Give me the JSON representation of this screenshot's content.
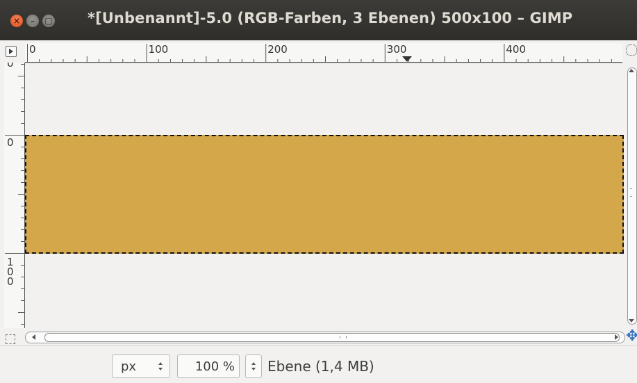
{
  "window": {
    "title": "*[Unbenannt]-5.0 (RGB-Farben, 3 Ebenen) 500x100 – GIMP",
    "close_glyph": "×",
    "minimize_glyph": "–",
    "maximize_glyph": "□"
  },
  "rulers": {
    "horizontal_labels": [
      "0",
      "100",
      "200",
      "300",
      "400"
    ],
    "vertical_labels": [
      "0",
      "0",
      "100"
    ]
  },
  "layer": {
    "color": "#d3a74a"
  },
  "statusbar": {
    "unit": "px",
    "zoom": "100 %",
    "layer_info": "Ebene (1,4 MB)"
  },
  "icons": {
    "menu": "triangle-right-icon",
    "zoom_toggle": "zoom-toggle-icon",
    "quick_mask": "quick-mask-icon",
    "navigate": "navigate-icon"
  }
}
